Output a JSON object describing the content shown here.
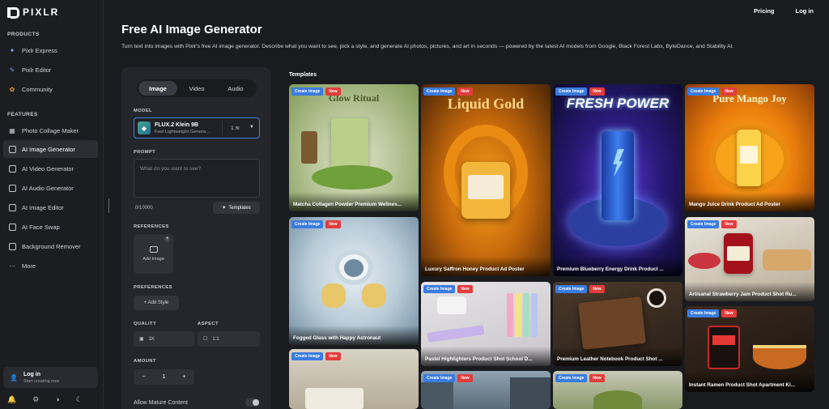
{
  "app": {
    "logo_text": "PIXLR"
  },
  "header": {
    "title": "Free AI Image Generator",
    "description": "Turn text into images with Pixlr's free AI image generator. Describe what you want to see, pick a style, and generate AI photos, pictures, and art in seconds — powered by the latest AI models from Google, Black Forest Labs, ByteDance, and Stability AI.",
    "links": {
      "pricing": "Pricing",
      "login": "Log in"
    }
  },
  "sidebar": {
    "products_label": "PRODUCTS",
    "products": [
      {
        "label": "Pixlr Express",
        "icon": "sparkle-icon"
      },
      {
        "label": "Pixlr Editor",
        "icon": "brush-icon"
      },
      {
        "label": "Community",
        "icon": "community-icon"
      }
    ],
    "features_label": "FEATURES",
    "features": [
      {
        "label": "Photo Collage Maker",
        "icon": "grid-icon"
      },
      {
        "label": "AI Image Generator",
        "icon": "image-sparkle-icon",
        "active": true
      },
      {
        "label": "AI Video Generator",
        "icon": "video-icon"
      },
      {
        "label": "AI Audio Generator",
        "icon": "audio-icon"
      },
      {
        "label": "AI Image Editor",
        "icon": "wand-icon"
      },
      {
        "label": "AI Face Swap",
        "icon": "face-swap-icon"
      },
      {
        "label": "Background Remover",
        "icon": "background-remover-icon"
      },
      {
        "label": "More",
        "icon": "more-icon"
      }
    ],
    "login": {
      "title": "Log in",
      "subtitle": "Start creating now"
    }
  },
  "panel": {
    "tabs": [
      "Image",
      "Video",
      "Audio"
    ],
    "active_tab": "Image",
    "model_label": "MODEL",
    "model": {
      "name": "FLUX.2 Klein 9B",
      "subtitle": "Fast Lightweight Genera...",
      "count": "1"
    },
    "prompt_label": "PROMPT",
    "prompt_placeholder": "What do you want to see?",
    "char_count": "0/10000",
    "templates_button": "Templates",
    "references_label": "REFERENCES",
    "add_image": "Add Image",
    "preferences_label": "PREFERENCES",
    "add_style": "+ Add Style",
    "quality_label": "QUALITY",
    "quality_value": "1K",
    "aspect_label": "ASPECT",
    "aspect_value": "1:1",
    "amount_label": "AMOUNT",
    "amount_value": "1",
    "mature_label": "Allow Mature Content"
  },
  "templates": {
    "title": "Templates",
    "badge_create": "Create Image",
    "badge_new": "New",
    "cards": [
      {
        "caption": "Matcha Collagen Powder Premium Wellnes...",
        "art": "Glow Ritual"
      },
      {
        "caption": "Fogged Glass with Happy Astronaut",
        "art": ""
      },
      {
        "caption": "",
        "art": ""
      },
      {
        "caption": "Luxury Saffron Honey Product Ad Poster",
        "art": "Liquid Gold"
      },
      {
        "caption": "Pastel Highlighters Product Shot School D...",
        "art": ""
      },
      {
        "caption": "",
        "art": ""
      },
      {
        "caption": "Premium Blueberry Energy Drink Product ...",
        "art": "FRESH POWER"
      },
      {
        "caption": "Premium Leather Notebook Product Shot ...",
        "art": ""
      },
      {
        "caption": "",
        "art": ""
      },
      {
        "caption": "Mango Juice Drink Product Ad Poster",
        "art": "Pure Mango Joy"
      },
      {
        "caption": "Artisanal Strawberry Jam Product Shot Ru...",
        "art": ""
      },
      {
        "caption": "Instant Ramen Product Shot Apartment Ki...",
        "art": ""
      }
    ]
  }
}
